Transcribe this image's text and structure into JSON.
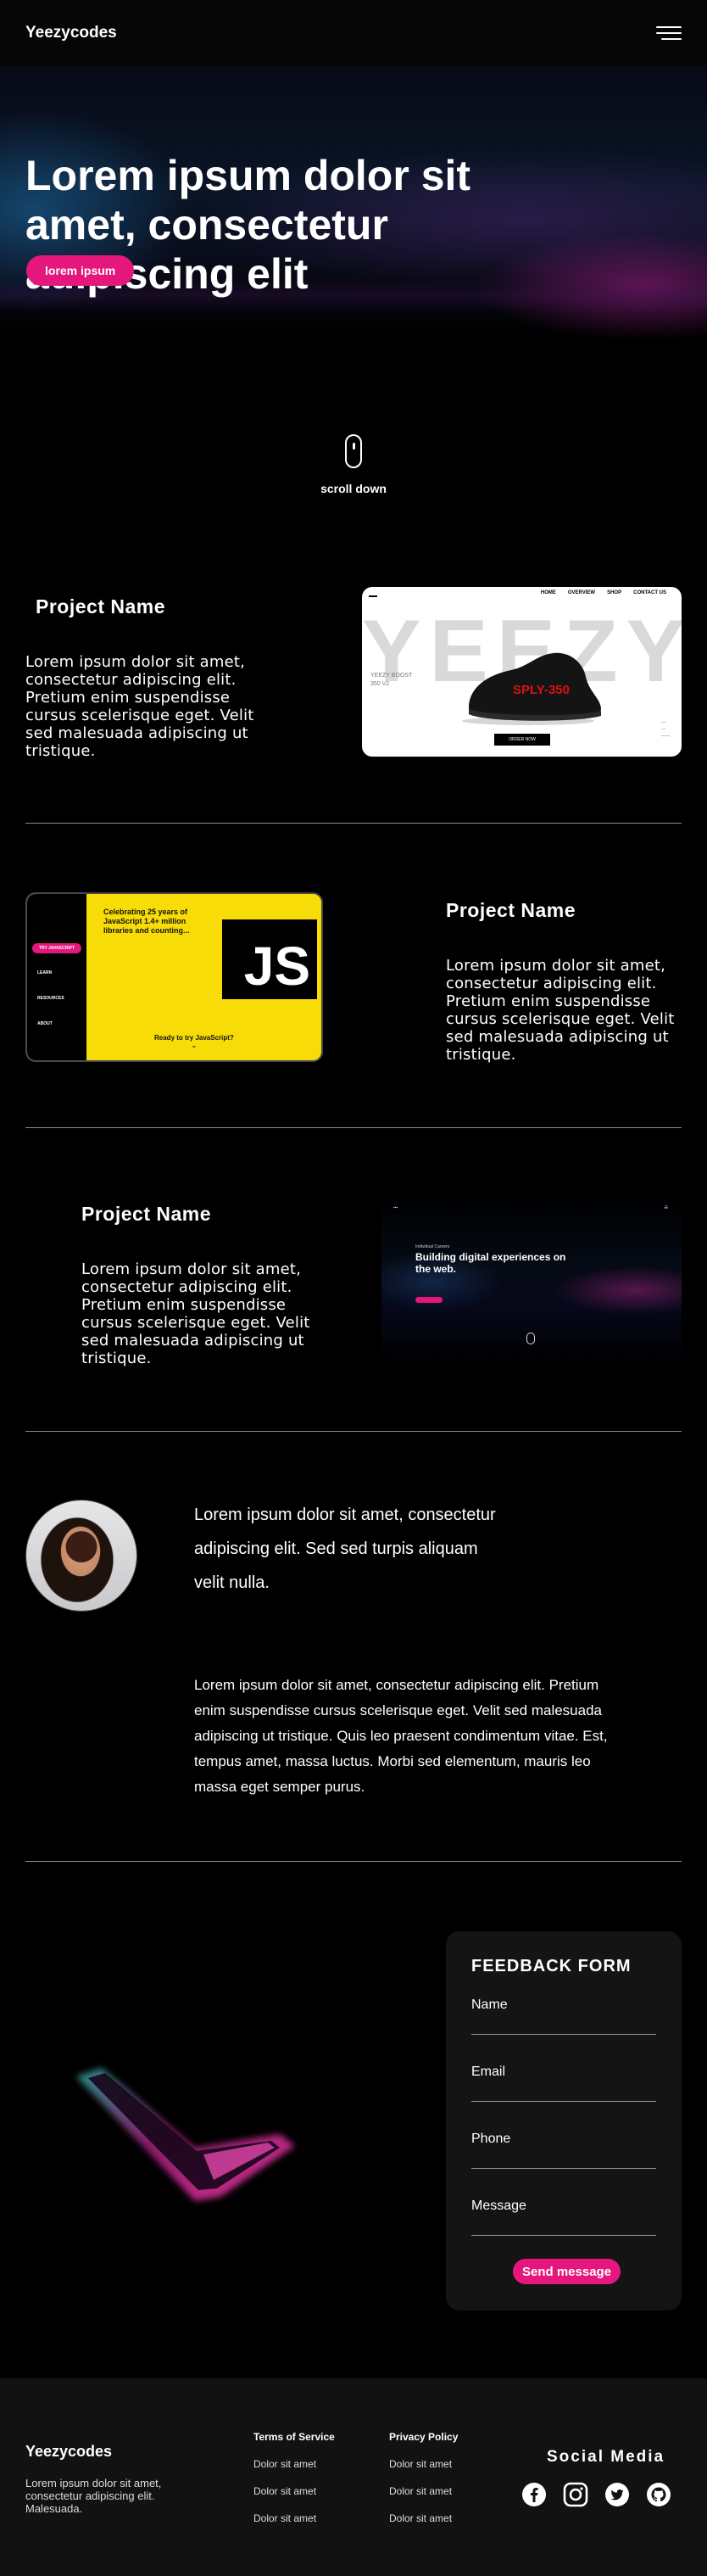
{
  "header": {
    "brand": "Yeezycodes",
    "menu_icon": "hamburger-menu-icon"
  },
  "hero": {
    "title": "Lorem ipsum dolor sit amet, consectetur adipiscing elit",
    "button_label": "lorem ipsum"
  },
  "scroll": {
    "label": "scroll down",
    "icon": "mouse-scroll-icon"
  },
  "projects": [
    {
      "title": "Project Name",
      "text": "Lorem ipsum dolor sit amet, consectetur adipiscing elit. Pretium enim suspendisse cursus scelerisque eget. Velit sed malesuada adipiscing ut tristique.",
      "preview": {
        "nav": [
          "HOME",
          "OVERVIEW",
          "SHOP",
          "CONTACT US"
        ],
        "big_word": "YEEZY",
        "sub_line1": "YEEZY BOOST",
        "sub_line2": "350 V2",
        "shoe_text": "SPLY-350",
        "order_label": "ORDER NOW"
      }
    },
    {
      "title": "Project Name",
      "text": "Lorem ipsum dolor sit amet, consectetur adipiscing elit. Pretium enim suspendisse cursus scelerisque eget. Velit sed malesuada adipiscing ut tristique.",
      "preview": {
        "headline": "Celebrating 25 years of JavaScript 1.4+ million libraries and counting...",
        "menu": [
          "TRY JAVASCRIPT",
          "LEARN",
          "RESOURCES",
          "ABOUT"
        ],
        "logo": "JS",
        "cta": "Ready to try JavaScript?"
      }
    },
    {
      "title": "Project Name",
      "text": "Lorem ipsum dolor sit amet, consectetur adipiscing elit. Pretium enim suspendisse cursus scelerisque eget. Velit sed malesuada adipiscing ut tristique.",
      "preview": {
        "kicker": "Individual Careers",
        "headline": "Building digital experiences on the web."
      }
    }
  ],
  "about": {
    "lead": "Lorem ipsum dolor sit amet, consectetur adipiscing elit. Sed sed turpis aliquam velit nulla.",
    "body": "Lorem ipsum dolor sit amet, consectetur adipiscing elit. Pretium enim suspendisse cursus scelerisque eget. Velit sed malesuada adipiscing ut tristique. Quis leo praesent condimentum vitae. Est, tempus amet, massa luctus. Morbi sed elementum, mauris leo massa eget semper purus."
  },
  "feedback": {
    "title": "FEEDBACK FORM",
    "fields": [
      "Name",
      "Email",
      "Phone",
      "Message"
    ],
    "send_label": "Send message"
  },
  "footer": {
    "brand": "Yeezycodes",
    "description": "Lorem ipsum dolor sit amet, consectetur adipiscing elit. Malesuada.",
    "terms": {
      "heading": "Terms of Service",
      "items": [
        "Dolor sit amet",
        "Dolor sit amet",
        "Dolor sit amet"
      ]
    },
    "privacy": {
      "heading": "Privacy Policy",
      "items": [
        "Dolor sit amet",
        "Dolor sit amet",
        "Dolor sit amet"
      ]
    },
    "social_title": "Social Media",
    "social_icons": [
      "facebook-icon",
      "instagram-icon",
      "twitter-icon",
      "github-icon"
    ]
  },
  "colors": {
    "accent": "#e5177c",
    "background": "#000000",
    "card": "#141414",
    "footer": "#121212"
  }
}
